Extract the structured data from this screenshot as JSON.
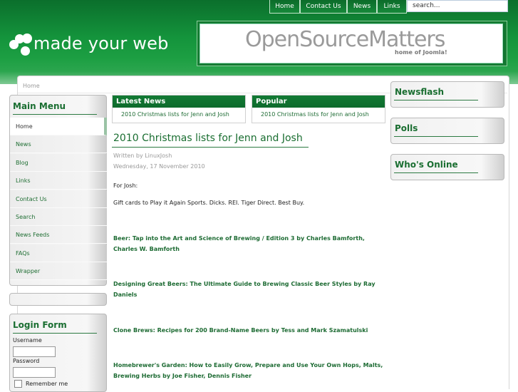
{
  "header": {
    "nav": [
      "Home",
      "Contact Us",
      "News",
      "Links"
    ],
    "search_placeholder": "search...",
    "logo_text": "made your web",
    "banner_title": "OpenSourceMatters",
    "banner_subtitle": "home of Joomla!"
  },
  "breadcrumb": "Home",
  "main_menu": {
    "title": "Main Menu",
    "items": [
      "Home",
      "News",
      "Blog",
      "Links",
      "Contact Us",
      "Search",
      "News Feeds",
      "FAQs",
      "Wrapper"
    ]
  },
  "login": {
    "title": "Login Form",
    "username_label": "Username",
    "password_label": "Password",
    "remember_label": "Remember me"
  },
  "latest_news": {
    "title": "Latest News",
    "item": "2010 Christmas lists for Jenn and Josh"
  },
  "popular": {
    "title": "Popular",
    "item": "2010 Christmas lists for Jenn and Josh"
  },
  "article": {
    "title": "2010 Christmas lists for Jenn and Josh",
    "author": "Written by LinuxJosh",
    "date": "Wednesday, 17 November 2010",
    "intro": "For Josh:",
    "gift_cards": "Gift cards to Play it Again Sports. Dicks. REI. Tiger Direct. Best Buy.",
    "books": [
      "Beer: Tap into the Art and Science of Brewing / Edition 3 by Charles Bamforth, Charles W. Bamforth",
      "Designing Great Beers: The Ultimate Guide to Brewing Classic Beer Styles by Ray Daniels",
      "Clone Brews: Recipes for 200 Brand-Name Beers by Tess and Mark Szamatulski",
      "Homebrewer's Garden: How to Easily Grow, Prepare and Use Your Own Hops, Malts, Brewing Herbs by Joe Fisher, Dennis Fisher"
    ]
  },
  "right_modules": [
    "Newsflash",
    "Polls",
    "Who's Online"
  ],
  "colors": {
    "brand_green": "#14943c",
    "link_green": "#1d6b33"
  }
}
